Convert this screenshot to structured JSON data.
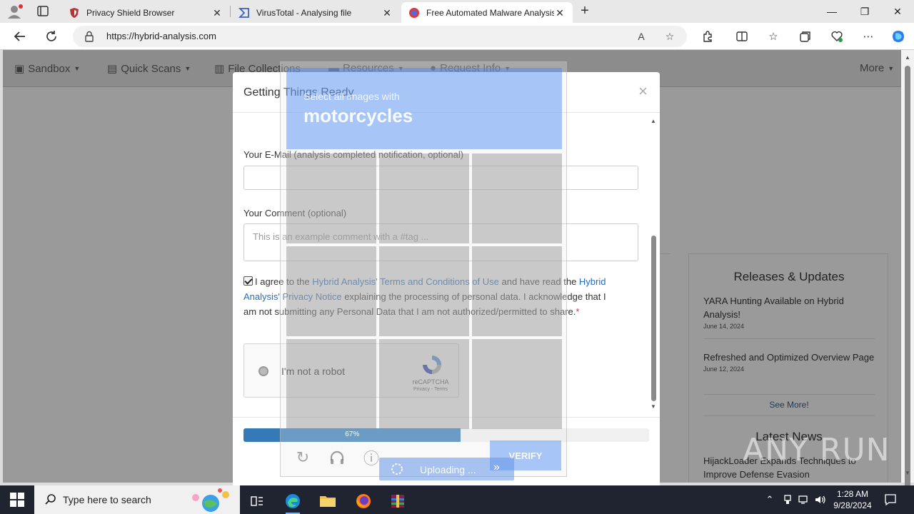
{
  "browser": {
    "tabs": [
      {
        "title": "Privacy Shield Browser",
        "active": false
      },
      {
        "title": "VirusTotal - Analysing file",
        "active": false
      },
      {
        "title": "Free Automated Malware Analysis",
        "active": true
      }
    ],
    "url": "https://hybrid-analysis.com"
  },
  "site_nav": {
    "items": [
      "Sandbox",
      "Quick Scans",
      "File Collections",
      "Resources",
      "Request Info"
    ],
    "more": "More"
  },
  "sidebar": {
    "releases_title": "Releases & Updates",
    "releases": [
      {
        "title": "YARA Hunting Available on Hybrid Analysis!",
        "date": "June 14, 2024"
      },
      {
        "title": "Refreshed and Optimized Overview Page",
        "date": "June 12, 2024"
      }
    ],
    "see_more": "See More!",
    "news_title": "Latest News",
    "news_first": "HijackLoader Expands Techniques to Improve Defense Evasion"
  },
  "modal": {
    "title": "Getting Things Ready",
    "close": "×",
    "email_label": "Your E-Mail (analysis completed notification, optional)",
    "comment_label": "Your Comment (optional)",
    "comment_placeholder": "This is an example comment with a #tag ...",
    "agree": {
      "t1": "I agree to the ",
      "link1": "Hybrid Analysis' Terms and Conditions of Use",
      "t2": " and have read the ",
      "link2": "Hybrid Analysis' Privacy Notice",
      "t3": " explaining the processing of personal data. I acknowledge that I am not submitting any Personal Data that I am not authorized/permitted to share.",
      "req": "*"
    },
    "recaptcha": {
      "label": "I'm not a robot",
      "brand": "reCAPTCHA",
      "links": "Privacy - Terms"
    },
    "progress": {
      "value": 0.536,
      "label": "67%"
    }
  },
  "challenge": {
    "line1": "Select all images with",
    "line2": "motorcycles",
    "verify": "VERIFY"
  },
  "upload": {
    "label": "Uploading ...",
    "arrow": "»"
  },
  "watermark": "ANY RUN",
  "taskbar": {
    "search_placeholder": "Type here to search",
    "time": "1:28 AM",
    "date": "9/28/2024"
  },
  "colors": {
    "accent": "#337ab7",
    "link": "#2a6ebb",
    "captcha_blue": "#4285f4"
  }
}
